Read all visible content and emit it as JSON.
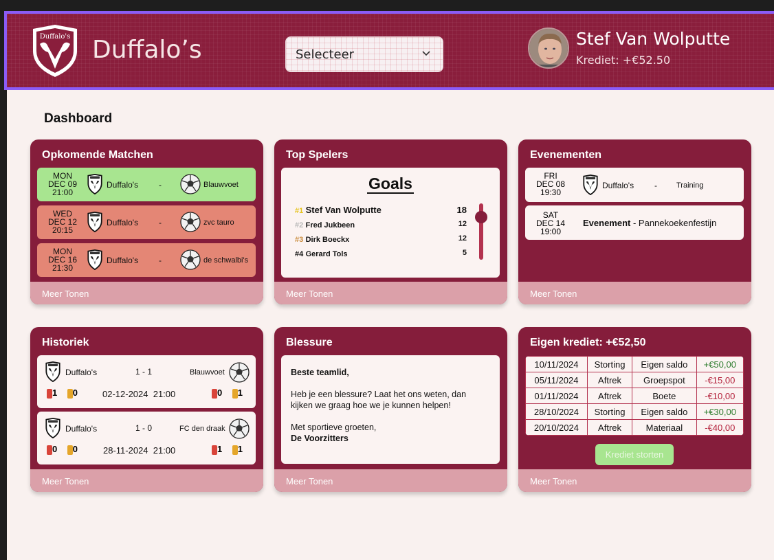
{
  "header": {
    "brand": "Duffalo’s",
    "select_label": "Selecteer",
    "user_name": "Stef Van Wolputte",
    "credit": "Krediet: +€52.50",
    "logo_text": "Duffalo's"
  },
  "dashboard": {
    "title": "Dashboard"
  },
  "upcoming": {
    "title": "Opkomende Matchen",
    "more": "Meer Tonen",
    "matches": [
      {
        "day": "MON",
        "date": "DEC 09",
        "time": "21:00",
        "home": "Duffalo's",
        "sep": "-",
        "away": "Blauwvoet",
        "color": "#a8e590"
      },
      {
        "day": "WED",
        "date": "DEC 12",
        "time": "20:15",
        "home": "Duffalo's",
        "sep": "-",
        "away": "zvc tauro",
        "color": "#e48675"
      },
      {
        "day": "MON",
        "date": "DEC 16",
        "time": "21:30",
        "home": "Duffalo's",
        "sep": "-",
        "away": "de schwalbi's",
        "color": "#e48675"
      }
    ]
  },
  "top": {
    "title": "Top Spelers",
    "more": "Meer Tonen",
    "goals_title": "Goals",
    "players": [
      {
        "rank": "#1",
        "name": "Stef Van Wolputte",
        "goals": "18"
      },
      {
        "rank": "#2",
        "name": "Fred Jukbeen",
        "goals": "12"
      },
      {
        "rank": "#3",
        "name": "Dirk Boeckx",
        "goals": "12"
      },
      {
        "rank": "#4",
        "name": "Gerard Tols",
        "goals": "5"
      }
    ]
  },
  "events": {
    "title": "Evenementen",
    "more": "Meer Tonen",
    "items": [
      {
        "day": "FRI",
        "date": "DEC 08",
        "time": "19:30",
        "team": "Duffalo's",
        "sep": "-",
        "label": "Training"
      },
      {
        "day": "SAT",
        "date": "DEC 14",
        "time": "19:00",
        "bold": "Evenement",
        "rest": " - Pannekoekenfestijn"
      }
    ]
  },
  "history": {
    "title": "Historiek",
    "more": "Meer Tonen",
    "games": [
      {
        "home": "Duffalo's",
        "score": "1 - 1",
        "away": "Blauwvoet",
        "datetime": "02-12-2024  21:00",
        "home_red": "1",
        "home_yellow": "0",
        "away_red": "0",
        "away_yellow": "1"
      },
      {
        "home": "Duffalo's",
        "score": "1 - 0",
        "away": "FC den draak",
        "datetime": "28-11-2024  21:00",
        "home_red": "0",
        "home_yellow": "0",
        "away_red": "1",
        "away_yellow": "1"
      }
    ]
  },
  "injury": {
    "title": "Blessure",
    "more": "Meer Tonen",
    "greeting": "Beste teamlid,",
    "body": "Heb je een blessure? Laat het ons weten, dan kijken we graag hoe we je kunnen helpen!",
    "closing": "Met sportieve groeten,",
    "signature": "De Voorzitters"
  },
  "credit_card": {
    "title": "Eigen krediet: +€52,50",
    "more": "Meer Tonen",
    "deposit": "Krediet storten",
    "rows": [
      {
        "date": "10/11/2024",
        "type": "Storting",
        "desc": "Eigen saldo",
        "amount": "+€50,00",
        "positive": true
      },
      {
        "date": "05/11/2024",
        "type": "Aftrek",
        "desc": "Groepspot",
        "amount": "-€15,00",
        "positive": false
      },
      {
        "date": "01/11/2024",
        "type": "Aftrek",
        "desc": "Boete",
        "amount": "-€10,00",
        "positive": false
      },
      {
        "date": "28/10/2024",
        "type": "Storting",
        "desc": "Eigen saldo",
        "amount": "+€30,00",
        "positive": true
      },
      {
        "date": "20/10/2024",
        "type": "Aftrek",
        "desc": "Materiaal",
        "amount": "-€40,00",
        "positive": false
      }
    ]
  },
  "colors": {
    "maroon": "#851d3b",
    "foot": "#dba0a9",
    "win": "#a8e590",
    "loss": "#e48675",
    "positive": "#2f7d2f",
    "negative": "#b3203a"
  }
}
